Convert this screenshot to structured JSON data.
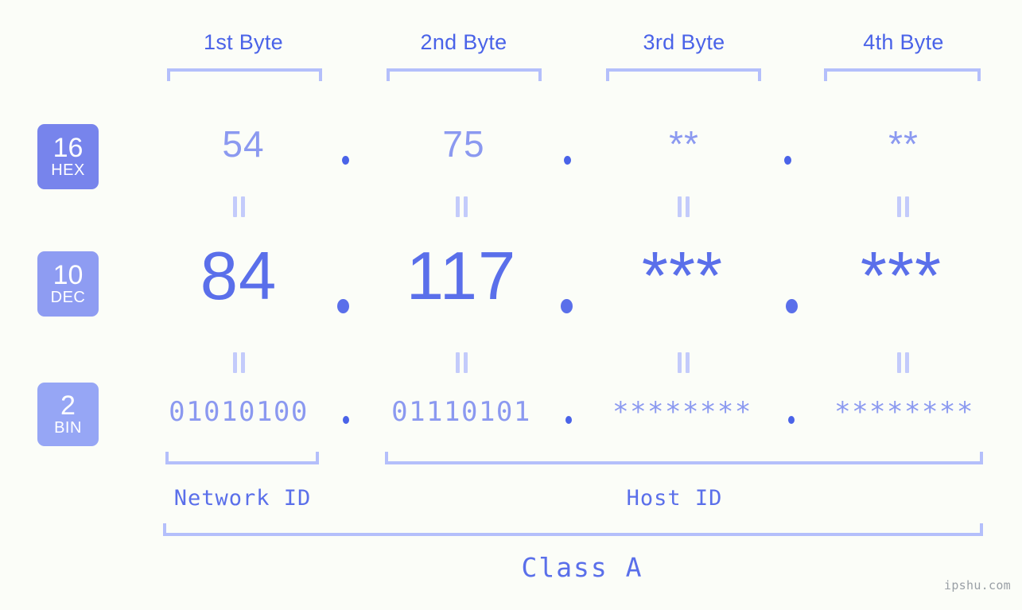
{
  "page": {
    "background_color": "#fbfdf8",
    "accent_color": "#5a6fea",
    "muted_accent_color": "#8b99f0",
    "bracket_color": "#b4bffb",
    "watermark": "ipshu.com"
  },
  "byte_headers": [
    {
      "label": "1st Byte"
    },
    {
      "label": "2nd Byte"
    },
    {
      "label": "3rd Byte"
    },
    {
      "label": "4th Byte"
    }
  ],
  "radix_badges": [
    {
      "number": "16",
      "abbr": "HEX",
      "color": "#7784ec"
    },
    {
      "number": "10",
      "abbr": "DEC",
      "color": "#8e9cf2"
    },
    {
      "number": "2",
      "abbr": "BIN",
      "color": "#96a6f5"
    }
  ],
  "rows": {
    "hex": {
      "radix": "16",
      "name": "HEX",
      "values": [
        "54",
        "75",
        "**",
        "**"
      ],
      "separators": [
        ".",
        ".",
        "."
      ]
    },
    "dec": {
      "radix": "10",
      "name": "DEC",
      "values": [
        "84",
        "117",
        "***",
        "***"
      ],
      "separators": [
        ".",
        ".",
        "."
      ]
    },
    "bin": {
      "radix": "2",
      "name": "BIN",
      "values": [
        "01010100",
        "01110101",
        "********",
        "********"
      ],
      "separators": [
        ".",
        ".",
        "."
      ]
    }
  },
  "equality_marks": {
    "glyph": "||",
    "count_per_row": 4
  },
  "segments": {
    "network_id": "Network ID",
    "host_id": "Host ID"
  },
  "class": {
    "label": "Class A"
  }
}
